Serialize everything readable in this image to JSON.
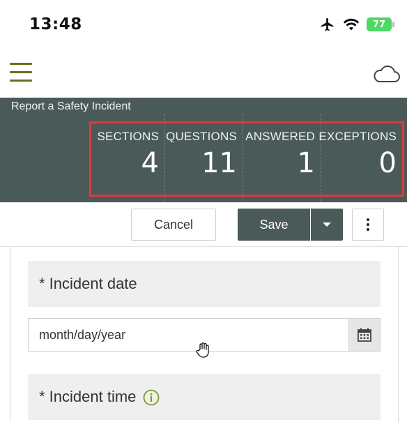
{
  "status_bar": {
    "time": "13:48",
    "battery": "77",
    "icons": [
      "airplane-icon",
      "wifi-icon",
      "battery-icon"
    ]
  },
  "header": {
    "menu_icon": "hamburger-menu-icon",
    "cloud_icon": "cloud-icon"
  },
  "form": {
    "title": "Report a Safety Incident",
    "stats": [
      {
        "label": "SECTIONS",
        "value": "4"
      },
      {
        "label": "QUESTIONS",
        "value": "11"
      },
      {
        "label": "ANSWERED",
        "value": "1"
      },
      {
        "label": "EXCEPTIONS",
        "value": "0"
      }
    ]
  },
  "toolbar": {
    "cancel_label": "Cancel",
    "save_label": "Save"
  },
  "questions": {
    "incident_date_label": "* Incident date",
    "incident_date_placeholder": "month/day/year",
    "incident_time_label": "* Incident time"
  },
  "colors": {
    "header_bg": "#4a5a58",
    "highlight_border": "#e0393e",
    "menu_olive": "#6b6f1c",
    "info_green": "#7a9a2a"
  }
}
